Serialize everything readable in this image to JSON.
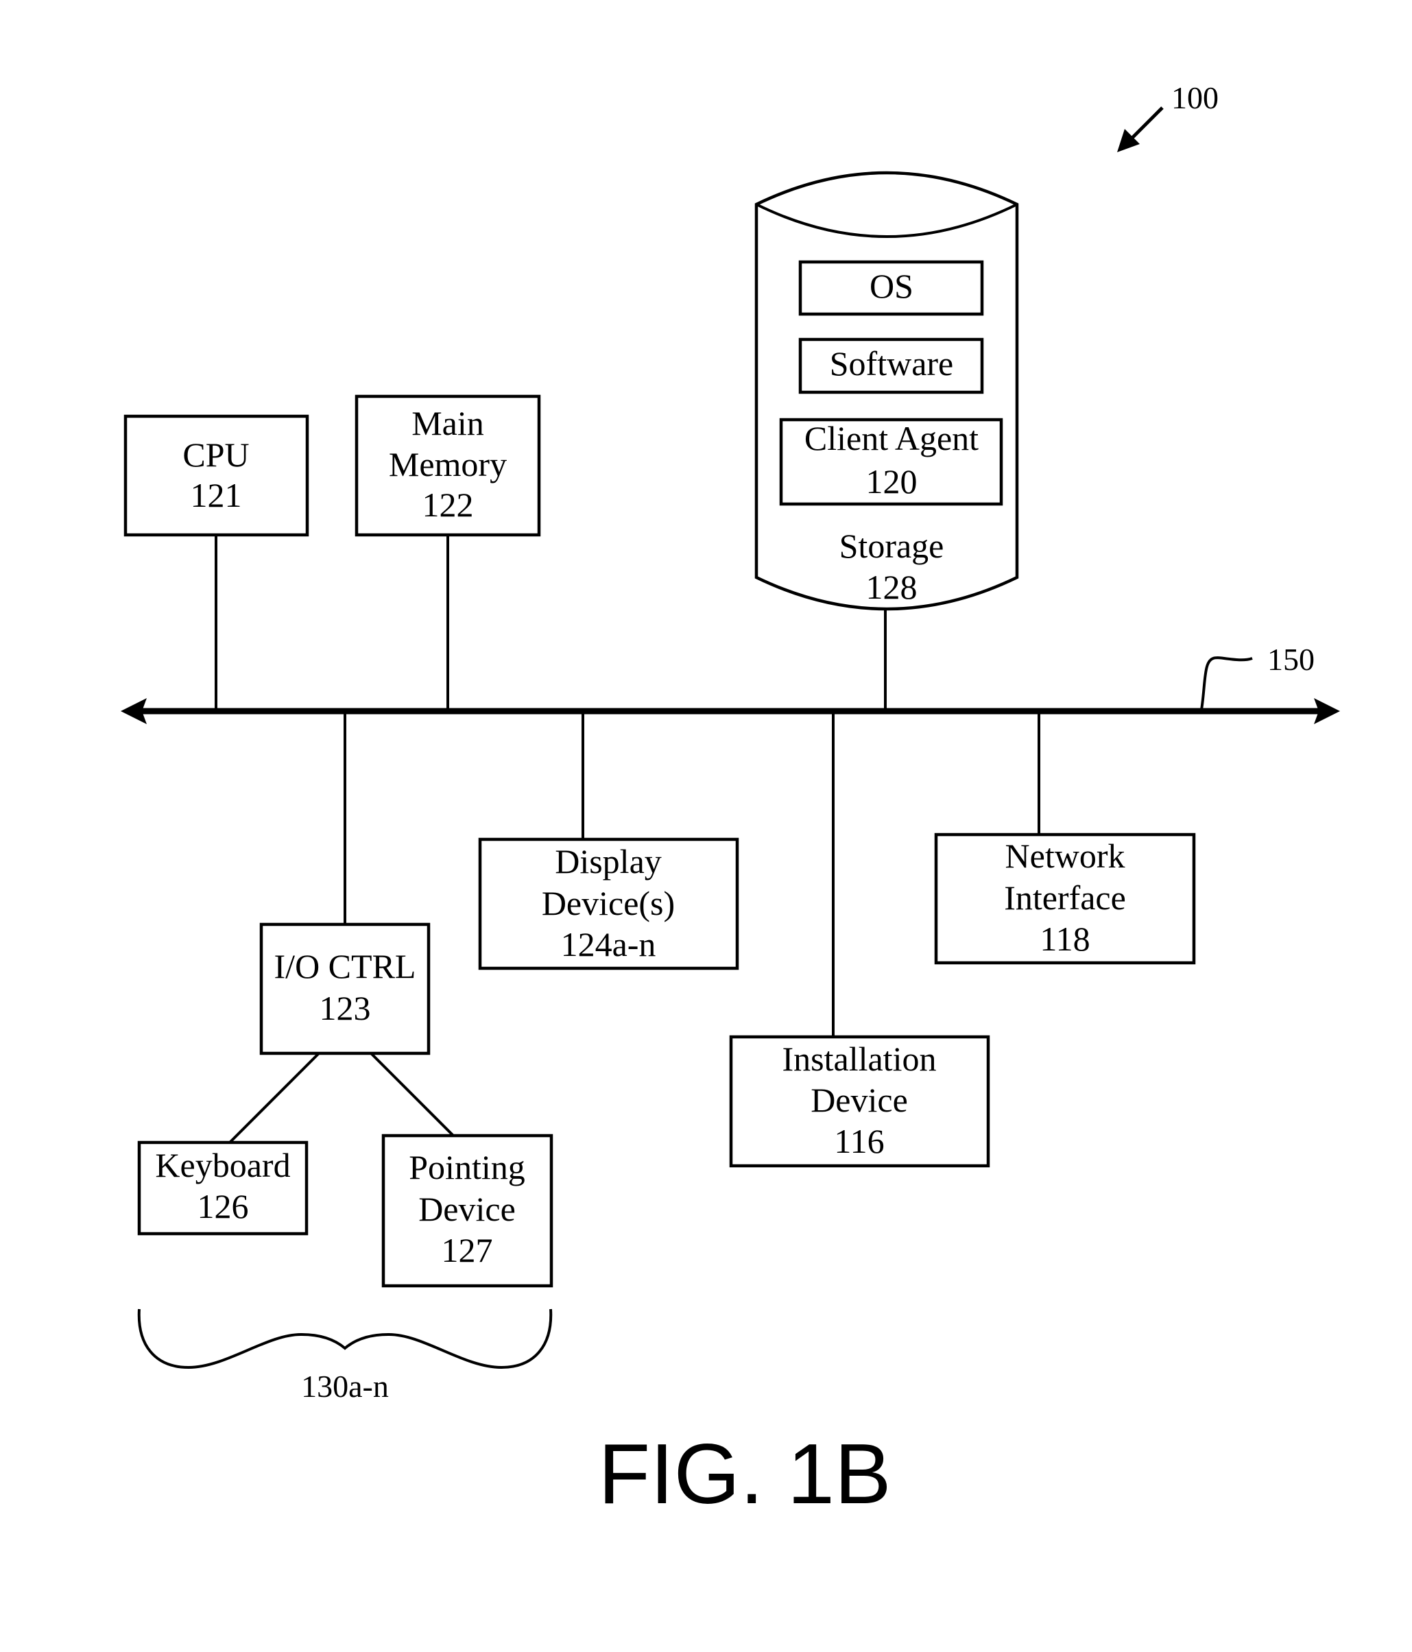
{
  "figure": {
    "title": "FIG. 1B",
    "reference": "100",
    "bus_reference": "150",
    "group_reference": "130a-n"
  },
  "components": {
    "cpu": {
      "lines": [
        "CPU",
        "121"
      ]
    },
    "main_memory": {
      "lines": [
        "Main",
        "Memory",
        "122"
      ]
    },
    "storage": {
      "lines": [
        "Storage",
        "128"
      ],
      "contents": {
        "os": {
          "lines": [
            "OS"
          ]
        },
        "software": {
          "lines": [
            "Software"
          ]
        },
        "client_agent": {
          "lines": [
            "Client Agent",
            "120"
          ]
        }
      }
    },
    "io_ctrl": {
      "lines": [
        "I/O CTRL",
        "123"
      ]
    },
    "display": {
      "lines": [
        "Display",
        "Device(s)",
        "124a-n"
      ]
    },
    "network": {
      "lines": [
        "Network",
        "Interface",
        "118"
      ]
    },
    "installation": {
      "lines": [
        "Installation",
        "Device",
        "116"
      ]
    },
    "keyboard": {
      "lines": [
        "Keyboard",
        "126"
      ]
    },
    "pointing": {
      "lines": [
        "Pointing",
        "Device",
        "127"
      ]
    }
  }
}
